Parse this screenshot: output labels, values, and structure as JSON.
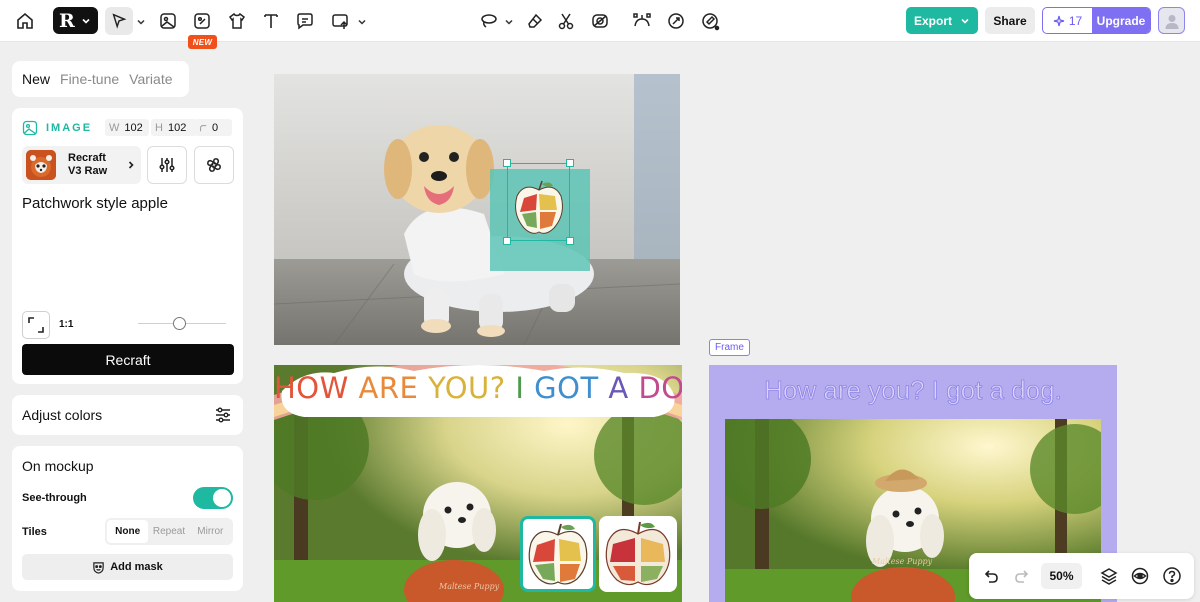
{
  "toolbar": {
    "new_badge": "NEW",
    "export_label": "Export",
    "share_label": "Share",
    "credits": "17",
    "upgrade_label": "Upgrade",
    "icons": [
      "home-icon",
      "recraft-logo",
      "select-arrow-icon",
      "image-icon",
      "sticker-icon",
      "mockup-shirt-icon",
      "text-icon",
      "comment-icon",
      "frame-upload-icon",
      "lasso-icon",
      "eraser-icon",
      "scissors-icon",
      "remove-bg-icon",
      "vectorize-icon",
      "creative-upscale-icon",
      "style-brush-icon"
    ]
  },
  "mode_tabs": [
    {
      "label": "New",
      "active": true
    },
    {
      "label": "Fine-tune",
      "active": false
    },
    {
      "label": "Variate",
      "active": false
    }
  ],
  "generator": {
    "section_label": "IMAGE",
    "width_key": "W",
    "width_value": "102",
    "height_key": "H",
    "height_value": "102",
    "corner_value": "0",
    "style_name_line1": "Recraft",
    "style_name_line2": "V3 Raw",
    "prompt": "Patchwork style apple",
    "ratio_label": "1:1",
    "ratio_slider_fraction": 0.47,
    "generate_label": "Recraft"
  },
  "adjust_colors": {
    "label": "Adjust colors"
  },
  "mockup": {
    "title": "On mockup",
    "see_through_label": "See-through",
    "see_through_on": true,
    "tiles_label": "Tiles",
    "tile_options": [
      {
        "label": "None",
        "selected": true
      },
      {
        "label": "Repeat",
        "selected": false
      },
      {
        "label": "Mirror",
        "selected": false
      }
    ],
    "mask_label": "Add mask"
  },
  "canvas": {
    "frame_label": "Frame",
    "sign_text": "HOW ARE YOU? I GOT A DOG.",
    "sign_colors": [
      "#e2553a",
      "#e9893a",
      "#d9b23a",
      "#4f9a4c",
      "#3f8fcf",
      "#6a57b8",
      "#c24a8f"
    ],
    "frame_title": "How are you? I got a dog.",
    "shirt_text": "Maltese Puppy"
  },
  "zoom": {
    "value": "50%"
  }
}
